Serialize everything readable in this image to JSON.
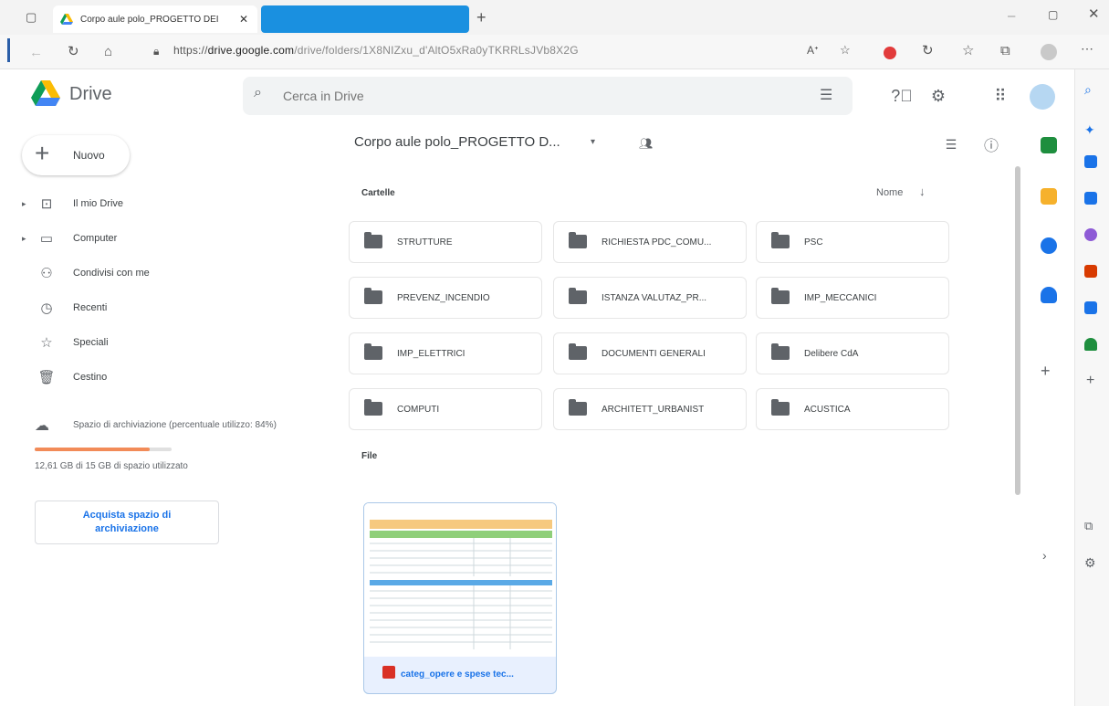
{
  "browser": {
    "tab_title": "Corpo aule polo_PROGETTO DEI",
    "url_prefix": "https://",
    "url_host": "drive.google.com",
    "url_path": "/drive/folders/1X8NIZxu_d'AltO5xRa0yTKRRLsJVb8X2G"
  },
  "drive": {
    "title": "Drive",
    "search_placeholder": "Cerca in Drive"
  },
  "sidebar": {
    "new_label": "Nuovo",
    "items": [
      {
        "label": "Il mio Drive",
        "icon": "my-drive-icon"
      },
      {
        "label": "Computer",
        "icon": "computer-icon"
      },
      {
        "label": "Condivisi con me",
        "icon": "shared-icon"
      },
      {
        "label": "Recenti",
        "icon": "clock-icon"
      },
      {
        "label": "Speciali",
        "icon": "star-icon"
      },
      {
        "label": "Cestino",
        "icon": "trash-icon"
      }
    ],
    "storage_label": "Spazio di archiviazione (percentuale utilizzo: 84%)",
    "storage_percent": 84,
    "storage_used": "12,61 GB di 15 GB di spazio utilizzato",
    "buy_label": "Acquista spazio di archiviazione"
  },
  "main": {
    "folder_path": "Corpo aule polo_PROGETTO D...",
    "section_folders": "Cartelle",
    "sort_label": "Nome",
    "folders": [
      "STRUTTURE",
      "RICHIESTA PDC_COMU...",
      "PSC",
      "PREVENZ_INCENDIO",
      "ISTANZA VALUTAZ_PR...",
      "IMP_MECCANICI",
      "IMP_ELETTRICI",
      "DOCUMENTI GENERALI",
      "Delibere CdA",
      "COMPUTI",
      "ARCHITETT_URBANIST",
      "ACUSTICA"
    ],
    "section_files": "File",
    "file_name": "categ_opere e spese tec..."
  },
  "colors": {
    "accent": "#1a73e8",
    "storage_fill": "#f28b58",
    "tab_blue": "#1a90e0"
  }
}
